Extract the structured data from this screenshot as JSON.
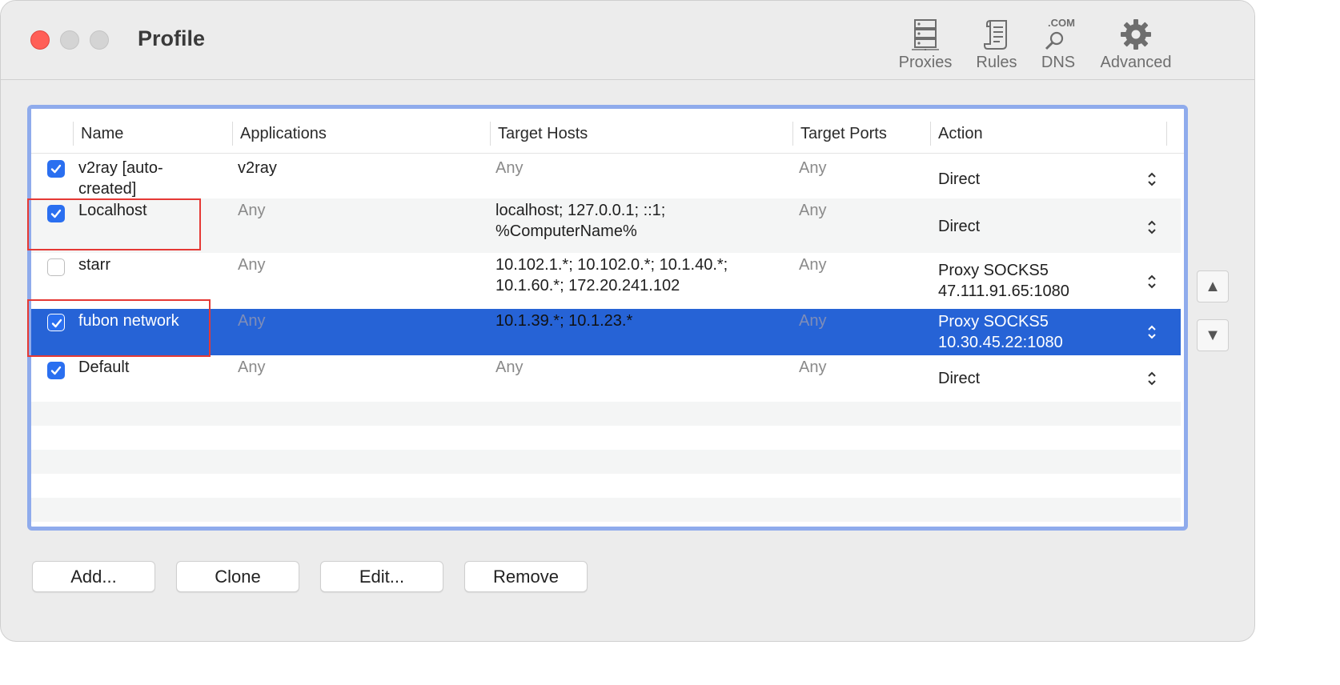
{
  "window": {
    "title": "Profile"
  },
  "toolbar": {
    "items": [
      {
        "label": "Proxies",
        "icon": "server-icon"
      },
      {
        "label": "Rules",
        "icon": "scroll-icon"
      },
      {
        "label": "DNS",
        "icon": "dns-icon",
        "icon_text": ".COM"
      },
      {
        "label": "Advanced",
        "icon": "gear-icon"
      }
    ]
  },
  "table": {
    "columns": [
      "Name",
      "Applications",
      "Target Hosts",
      "Target Ports",
      "Action"
    ],
    "rows": [
      {
        "checked": true,
        "name": "v2ray [auto-created]",
        "name_l1": "v2ray [auto-",
        "name_l2": "created]",
        "applications": "v2ray",
        "hosts_l1": "Any",
        "hosts_l2": "",
        "ports": "Any",
        "action_l1": "Direct",
        "action_l2": ""
      },
      {
        "checked": true,
        "name": "Localhost",
        "applications": "Any",
        "hosts_l1": "localhost; 127.0.0.1; ::1;",
        "hosts_l2": "%ComputerName%",
        "ports": "Any",
        "action_l1": "Direct",
        "action_l2": ""
      },
      {
        "checked": false,
        "name": "starr",
        "applications": "Any",
        "hosts_l1": "10.102.1.*; 10.102.0.*; 10.1.40.*;",
        "hosts_l2": "10.1.60.*; 172.20.241.102",
        "ports": "Any",
        "action_l1": "Proxy SOCKS5",
        "action_l2": "47.111.91.65:1080"
      },
      {
        "checked": true,
        "name": "fubon network",
        "applications": "Any",
        "hosts_l1": "10.1.39.*; 10.1.23.*",
        "hosts_l2": "",
        "ports": "Any",
        "action_l1": "Proxy SOCKS5",
        "action_l2": "10.30.45.22:1080",
        "selected": true
      },
      {
        "checked": true,
        "name": "Default",
        "applications": "Any",
        "hosts_l1": "Any",
        "hosts_l2": "",
        "ports": "Any",
        "action_l1": "Direct",
        "action_l2": ""
      }
    ]
  },
  "side_buttons": {
    "up": "▲",
    "down": "▼"
  },
  "buttons": {
    "add": "Add...",
    "clone": "Clone",
    "edit": "Edit...",
    "remove": "Remove"
  },
  "colors": {
    "accent": "#2663d6",
    "selection": "#2663d6",
    "table_focus_ring": "#8fabec",
    "highlight": "#e53935"
  }
}
